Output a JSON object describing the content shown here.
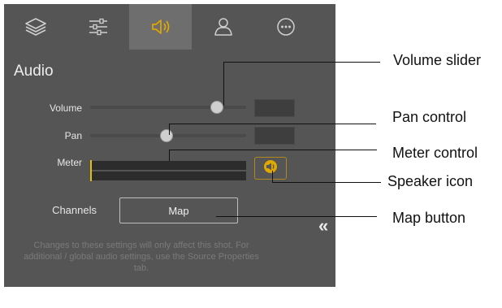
{
  "tabs": [
    {
      "icon": "layers-icon"
    },
    {
      "icon": "sliders-icon"
    },
    {
      "icon": "speaker-icon",
      "active": true
    },
    {
      "icon": "person-icon"
    },
    {
      "icon": "more-icon"
    }
  ],
  "audio": {
    "title": "Audio",
    "volume": {
      "label": "Volume",
      "level": 0.81,
      "value": ""
    },
    "pan": {
      "label": "Pan",
      "level": 0.49,
      "value": ""
    },
    "meter": {
      "label": "Meter",
      "level": 0.01
    },
    "channels": {
      "label": "Channels",
      "button_label": "Map"
    },
    "note": "Changes to these settings will only affect this shot. For additional / global audio settings, use the Source Properties tab."
  },
  "collapse_icon": "«",
  "callouts": {
    "volume_slider": "Volume slider",
    "pan_control": "Pan control",
    "meter_control": "Meter control",
    "speaker_icon": "Speaker icon",
    "map_button": "Map button"
  },
  "colors": {
    "panel_bg": "#555555",
    "active_tab_bg": "#6e6e6e",
    "accent": "#e0a800",
    "meter_level": "#e0c000"
  }
}
